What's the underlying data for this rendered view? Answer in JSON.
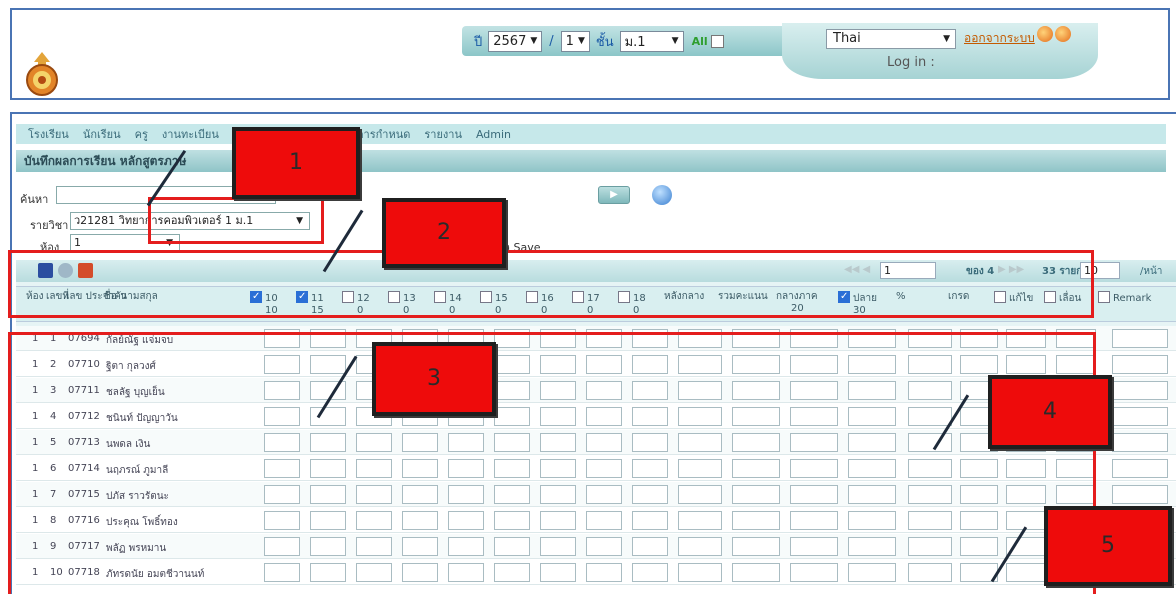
{
  "header": {
    "year_label": "ปี",
    "year_value": "2567",
    "separator": "/",
    "term_value": "1",
    "class_label": "ชั้น",
    "class_value": "ม.1",
    "all_label": "All",
    "language_value": "Thai",
    "logout_label": "ออกจากระบบ",
    "login_label": "Log in :"
  },
  "menu": {
    "items": [
      "โรงเรียน",
      "นักเรียน",
      "ครู",
      "งานทะเบียน",
      "การกำหนด",
      "รายงาน",
      "Admin"
    ]
  },
  "page": {
    "title": "บันทึกผลการเรียน หลักสูตรภาษ"
  },
  "filter": {
    "search_label": "ค้นหา",
    "subject_label": "รายวิชา",
    "subject_value": "ว21281 วิทยาการคอมพิวเตอร์ 1 ม.1",
    "room_label": "ห้อง",
    "room_value": "1",
    "note": "มูล Save"
  },
  "pager": {
    "page_value": "1",
    "of_label": "ของ 4",
    "total_label": "33 รายการ",
    "page_size_value": "10",
    "per_page_label": "/หน้า"
  },
  "columns": [
    {
      "label": "ห้อง",
      "sub": ""
    },
    {
      "label": "เลขที่",
      "sub": ""
    },
    {
      "label": "เลข ประจำตัว",
      "sub": ""
    },
    {
      "label": "ชื่อ-นามสกุล",
      "sub": ""
    },
    {
      "label": "10",
      "sub": "10",
      "checked": true
    },
    {
      "label": "11",
      "sub": "15",
      "checked": true
    },
    {
      "label": "12",
      "sub": "0",
      "checked": false
    },
    {
      "label": "13",
      "sub": "0",
      "checked": false
    },
    {
      "label": "14",
      "sub": "0",
      "checked": false
    },
    {
      "label": "15",
      "sub": "0",
      "checked": false
    },
    {
      "label": "16",
      "sub": "0",
      "checked": false
    },
    {
      "label": "17",
      "sub": "0",
      "checked": false
    },
    {
      "label": "18",
      "sub": "0",
      "checked": false
    },
    {
      "label": "หลังกลาง",
      "sub": ""
    },
    {
      "label": "รวมคะแนน",
      "sub": ""
    },
    {
      "label": "กลางภาค",
      "sub": "20"
    },
    {
      "label": "ปลาย",
      "sub": "30",
      "checked": true
    },
    {
      "label": "%",
      "sub": ""
    },
    {
      "label": "เกรด",
      "sub": ""
    },
    {
      "label": "แก้ไข",
      "sub": "",
      "checked": false
    },
    {
      "label": "เลื่อน",
      "sub": "",
      "checked": false
    },
    {
      "label": "Remark",
      "sub": "",
      "checked": false
    }
  ],
  "rows": [
    {
      "room": "1",
      "no": "1",
      "id": "07694",
      "name": "กัลย์ณัฐ แจ่มจบ"
    },
    {
      "room": "1",
      "no": "2",
      "id": "07710",
      "name": "ฐิตา กุลวงศ์"
    },
    {
      "room": "1",
      "no": "3",
      "id": "07711",
      "name": "ชลลัฐ บุญเย็น"
    },
    {
      "room": "1",
      "no": "4",
      "id": "07712",
      "name": "ชนินท์ ปัญญาวัน"
    },
    {
      "room": "1",
      "no": "5",
      "id": "07713",
      "name": "นพดล เงิน"
    },
    {
      "room": "1",
      "no": "6",
      "id": "07714",
      "name": "นฤภรณ์ ภูมาลี"
    },
    {
      "room": "1",
      "no": "7",
      "id": "07715",
      "name": "ปภัส ราวรัตนะ"
    },
    {
      "room": "1",
      "no": "8",
      "id": "07716",
      "name": "ประคุณ โพธิ์ทอง"
    },
    {
      "room": "1",
      "no": "9",
      "id": "07717",
      "name": "พลัฏ พรหมาน"
    },
    {
      "room": "1",
      "no": "10",
      "id": "07718",
      "name": "ภัทรดนัย อมตชีวานนท์"
    }
  ],
  "callouts": [
    "1",
    "2",
    "3",
    "4",
    "5"
  ],
  "colors": {
    "annotation_red": "#e41d1d",
    "callout_fill": "#ee0b0b",
    "frame_blue": "#4a74b4",
    "teal_bar": "#8cc6c8"
  }
}
